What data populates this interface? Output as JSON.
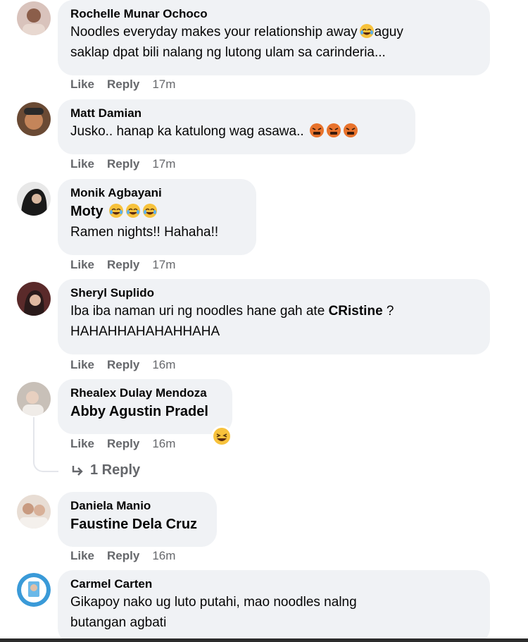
{
  "comments": [
    {
      "author": "Rochelle Munar Ochoco",
      "line1": "Noodles everyday makes your relationship away",
      "line1_after": "aguy",
      "line2": "saklap dpat bili nalang ng lutong ulam sa carinderia...",
      "like": "Like",
      "reply": "Reply",
      "time": "17m",
      "avatar_color": "#c9a8a0"
    },
    {
      "author": "Matt Damian",
      "text": "Jusko.. hanap ka katulong wag asawa..",
      "like": "Like",
      "reply": "Reply",
      "time": "17m",
      "avatar_color": "#8a5a3a"
    },
    {
      "author": "Monik Agbayani",
      "strong": "Moty",
      "text": "Ramen nights!! Hahaha!!",
      "like": "Like",
      "reply": "Reply",
      "time": "17m",
      "avatar_color": "#2a2a2a"
    },
    {
      "author": "Sheryl Suplido",
      "line1": "Iba iba naman uri ng noodles hane gah ate",
      "mention": "CRistine",
      "line1_after": "?",
      "line2": "HAHAHHAHAHAHHAHA",
      "like": "Like",
      "reply": "Reply",
      "time": "16m",
      "avatar_color": "#7a3a3a"
    },
    {
      "author": "Rhealex Dulay Mendoza",
      "strong": "Abby Agustin Pradel",
      "like": "Like",
      "reply": "Reply",
      "time": "16m",
      "replies_label": "1 Reply",
      "avatar_color": "#b8b0a8"
    },
    {
      "author": "Daniela Manio",
      "strong": "Faustine Dela Cruz",
      "like": "Like",
      "reply": "Reply",
      "time": "16m",
      "avatar_color": "#d8c4b8"
    },
    {
      "author": "Carmel Carten",
      "line1": "Gikapoy nako ug luto putahi, mao noodles nalng",
      "line2": "butangan agbati",
      "avatar_color": "#3a8fc8"
    }
  ],
  "colors": {
    "bubble": "#f0f2f5",
    "meta": "#65676b",
    "text": "#050505"
  }
}
